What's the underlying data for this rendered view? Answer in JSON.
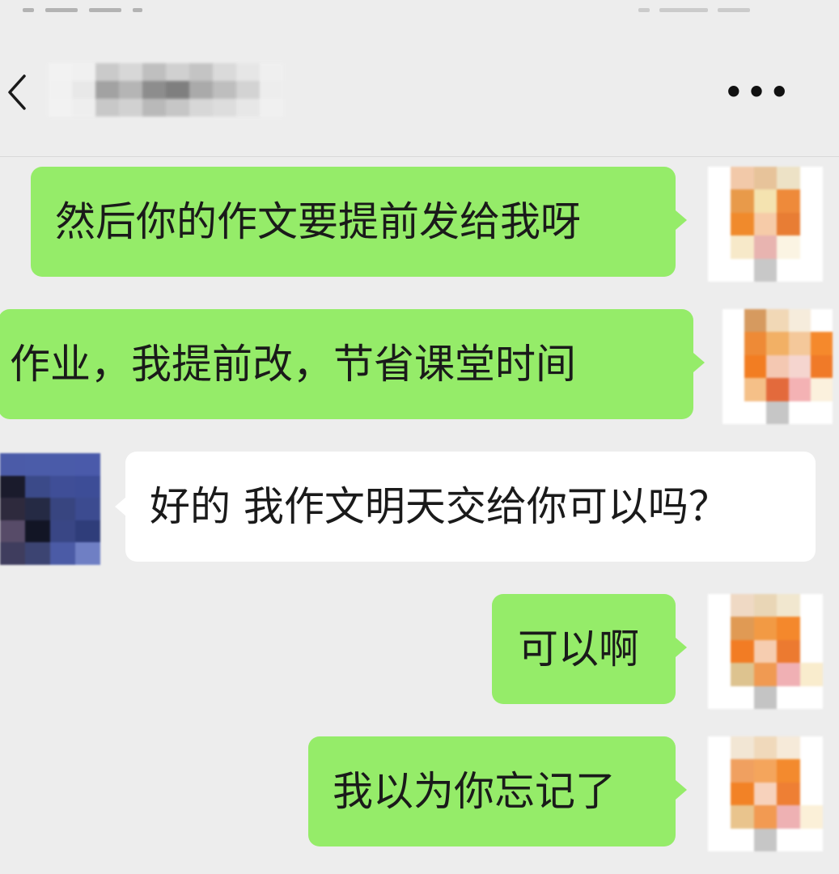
{
  "header": {
    "title": "",
    "more_label": "•••"
  },
  "messages": [
    {
      "side": "out",
      "text": "然后你的作文要提前发给我呀"
    },
    {
      "side": "out",
      "text": "作业，我提前改，节省课堂时间"
    },
    {
      "side": "in",
      "text": "好的 我作文明天交给你可以吗？"
    },
    {
      "side": "out",
      "text": "可以啊"
    },
    {
      "side": "out",
      "text": "我以为你忘记了"
    }
  ],
  "colors": {
    "background": "#ededed",
    "outgoing_bubble": "#95ec69",
    "incoming_bubble": "#ffffff",
    "text": "#1a1a1a"
  },
  "icons": {
    "back": "chevron-left-icon",
    "more": "more-dots-icon"
  }
}
